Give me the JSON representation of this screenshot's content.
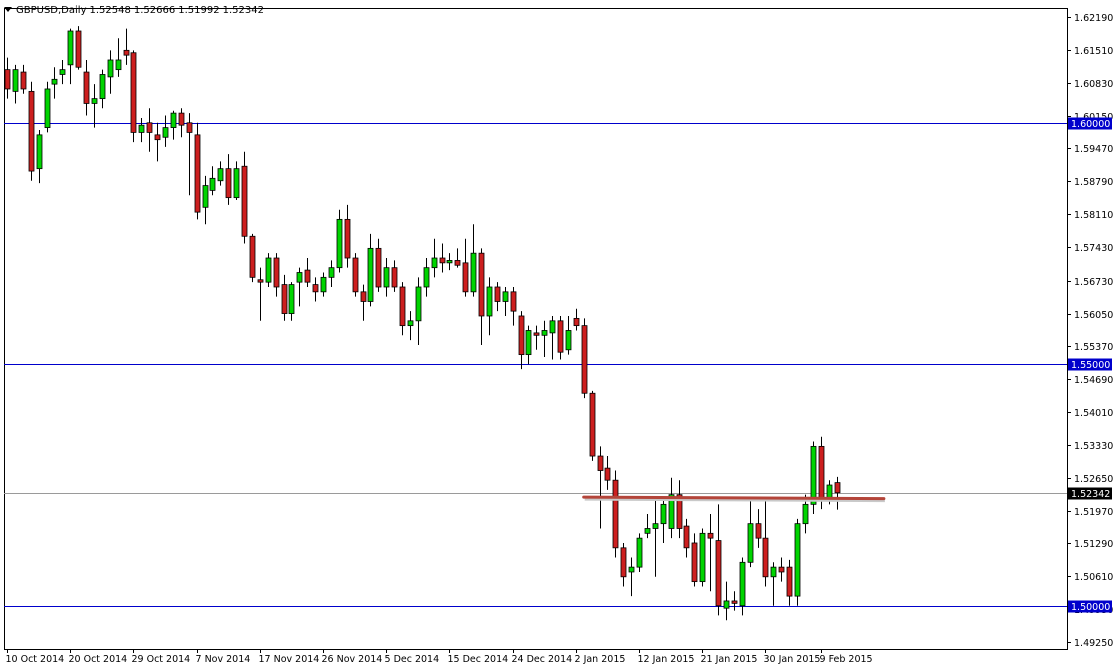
{
  "header": {
    "symbol": "GBPUSD,Daily",
    "open": "1.52548",
    "high": "1.52666",
    "low": "1.51992",
    "close": "1.52342"
  },
  "colors": {
    "bull": "#00d400",
    "bear": "#cc1f1f",
    "wick": "#000000",
    "hline": "#0000cc",
    "resistance": "#b4453a",
    "bidline": "#9a9a9a",
    "axis": "#000000"
  },
  "chart_data": {
    "type": "candlestick",
    "symbol": "GBPUSD",
    "timeframe": "Daily",
    "ylim": [
      1.4925,
      1.6219
    ],
    "y_ticks": [
      "1.62190",
      "1.61510",
      "1.60830",
      "1.60150",
      "1.59470",
      "1.58790",
      "1.58110",
      "1.57430",
      "1.56730",
      "1.56050",
      "1.55370",
      "1.54690",
      "1.54010",
      "1.53330",
      "1.52650",
      "1.51970",
      "1.51290",
      "1.50610",
      "1.49930",
      "1.49250"
    ],
    "x_labels": [
      "10 Oct 2014",
      "20 Oct 2014",
      "29 Oct 2014",
      "7 Nov 2014",
      "17 Nov 2014",
      "26 Nov 2014",
      "5 Dec 2014",
      "15 Dec 2014",
      "24 Dec 2014",
      "2 Jan 2015",
      "12 Jan 2015",
      "21 Jan 2015",
      "30 Jan 2015",
      "9 Feb 2015"
    ],
    "x_label_index": [
      0,
      8,
      16,
      24,
      32,
      40,
      48,
      56,
      64,
      72,
      80,
      88,
      96,
      103
    ],
    "horizontal_lines": [
      {
        "label": "1.60000",
        "price": 1.6
      },
      {
        "label": "1.55000",
        "price": 1.55
      },
      {
        "label": "1.50000",
        "price": 1.5
      }
    ],
    "current_price": {
      "label": "1.52342",
      "price": 1.52342
    },
    "resistance_line": {
      "start_index": 73,
      "end_index": 111,
      "price": 1.5225
    },
    "candles": [
      {
        "o": 1.611,
        "h": 1.6135,
        "l": 1.605,
        "c": 1.607
      },
      {
        "o": 1.6065,
        "h": 1.612,
        "l": 1.604,
        "c": 1.611
      },
      {
        "o": 1.6105,
        "h": 1.612,
        "l": 1.606,
        "c": 1.607
      },
      {
        "o": 1.6065,
        "h": 1.6085,
        "l": 1.588,
        "c": 1.59
      },
      {
        "o": 1.5905,
        "h": 1.5985,
        "l": 1.5875,
        "c": 1.5975
      },
      {
        "o": 1.599,
        "h": 1.6085,
        "l": 1.598,
        "c": 1.607
      },
      {
        "o": 1.608,
        "h": 1.6115,
        "l": 1.605,
        "c": 1.609
      },
      {
        "o": 1.61,
        "h": 1.613,
        "l": 1.608,
        "c": 1.611
      },
      {
        "o": 1.612,
        "h": 1.6195,
        "l": 1.608,
        "c": 1.619
      },
      {
        "o": 1.619,
        "h": 1.62,
        "l": 1.611,
        "c": 1.6115
      },
      {
        "o": 1.6105,
        "h": 1.613,
        "l": 1.6015,
        "c": 1.604
      },
      {
        "o": 1.604,
        "h": 1.608,
        "l": 1.599,
        "c": 1.605
      },
      {
        "o": 1.605,
        "h": 1.611,
        "l": 1.603,
        "c": 1.61
      },
      {
        "o": 1.6095,
        "h": 1.615,
        "l": 1.606,
        "c": 1.613
      },
      {
        "o": 1.611,
        "h": 1.6175,
        "l": 1.6095,
        "c": 1.613
      },
      {
        "o": 1.615,
        "h": 1.6195,
        "l": 1.612,
        "c": 1.614
      },
      {
        "o": 1.6145,
        "h": 1.615,
        "l": 1.596,
        "c": 1.598
      },
      {
        "o": 1.598,
        "h": 1.601,
        "l": 1.596,
        "c": 1.5995
      },
      {
        "o": 1.6,
        "h": 1.603,
        "l": 1.594,
        "c": 1.598
      },
      {
        "o": 1.5975,
        "h": 1.6,
        "l": 1.592,
        "c": 1.5965
      },
      {
        "o": 1.597,
        "h": 1.6015,
        "l": 1.595,
        "c": 1.599
      },
      {
        "o": 1.599,
        "h": 1.6025,
        "l": 1.5965,
        "c": 1.602
      },
      {
        "o": 1.602,
        "h": 1.603,
        "l": 1.597,
        "c": 1.5995
      },
      {
        "o": 1.6,
        "h": 1.602,
        "l": 1.585,
        "c": 1.598
      },
      {
        "o": 1.5975,
        "h": 1.6,
        "l": 1.58,
        "c": 1.5815
      },
      {
        "o": 1.5825,
        "h": 1.589,
        "l": 1.579,
        "c": 1.587
      },
      {
        "o": 1.586,
        "h": 1.591,
        "l": 1.585,
        "c": 1.5885
      },
      {
        "o": 1.588,
        "h": 1.592,
        "l": 1.587,
        "c": 1.5905
      },
      {
        "o": 1.5905,
        "h": 1.5935,
        "l": 1.583,
        "c": 1.5845
      },
      {
        "o": 1.5845,
        "h": 1.592,
        "l": 1.584,
        "c": 1.5905
      },
      {
        "o": 1.591,
        "h": 1.594,
        "l": 1.575,
        "c": 1.5765
      },
      {
        "o": 1.5765,
        "h": 1.577,
        "l": 1.567,
        "c": 1.568
      },
      {
        "o": 1.5675,
        "h": 1.57,
        "l": 1.559,
        "c": 1.567
      },
      {
        "o": 1.567,
        "h": 1.573,
        "l": 1.566,
        "c": 1.572
      },
      {
        "o": 1.572,
        "h": 1.573,
        "l": 1.564,
        "c": 1.566
      },
      {
        "o": 1.5665,
        "h": 1.5685,
        "l": 1.559,
        "c": 1.5605
      },
      {
        "o": 1.5605,
        "h": 1.567,
        "l": 1.559,
        "c": 1.5665
      },
      {
        "o": 1.567,
        "h": 1.57,
        "l": 1.562,
        "c": 1.569
      },
      {
        "o": 1.5695,
        "h": 1.572,
        "l": 1.566,
        "c": 1.567
      },
      {
        "o": 1.5665,
        "h": 1.568,
        "l": 1.563,
        "c": 1.565
      },
      {
        "o": 1.565,
        "h": 1.569,
        "l": 1.564,
        "c": 1.568
      },
      {
        "o": 1.568,
        "h": 1.5715,
        "l": 1.566,
        "c": 1.57
      },
      {
        "o": 1.57,
        "h": 1.582,
        "l": 1.569,
        "c": 1.58
      },
      {
        "o": 1.58,
        "h": 1.583,
        "l": 1.57,
        "c": 1.572
      },
      {
        "o": 1.572,
        "h": 1.573,
        "l": 1.564,
        "c": 1.565
      },
      {
        "o": 1.565,
        "h": 1.5665,
        "l": 1.559,
        "c": 1.563
      },
      {
        "o": 1.563,
        "h": 1.577,
        "l": 1.562,
        "c": 1.574
      },
      {
        "o": 1.574,
        "h": 1.576,
        "l": 1.565,
        "c": 1.566
      },
      {
        "o": 1.566,
        "h": 1.572,
        "l": 1.564,
        "c": 1.57
      },
      {
        "o": 1.57,
        "h": 1.5715,
        "l": 1.565,
        "c": 1.566
      },
      {
        "o": 1.566,
        "h": 1.567,
        "l": 1.556,
        "c": 1.558
      },
      {
        "o": 1.558,
        "h": 1.561,
        "l": 1.555,
        "c": 1.559
      },
      {
        "o": 1.559,
        "h": 1.568,
        "l": 1.554,
        "c": 1.566
      },
      {
        "o": 1.566,
        "h": 1.572,
        "l": 1.564,
        "c": 1.57
      },
      {
        "o": 1.57,
        "h": 1.576,
        "l": 1.568,
        "c": 1.572
      },
      {
        "o": 1.572,
        "h": 1.575,
        "l": 1.569,
        "c": 1.571
      },
      {
        "o": 1.571,
        "h": 1.573,
        "l": 1.5695,
        "c": 1.5715
      },
      {
        "o": 1.5715,
        "h": 1.574,
        "l": 1.57,
        "c": 1.5705
      },
      {
        "o": 1.571,
        "h": 1.576,
        "l": 1.564,
        "c": 1.565
      },
      {
        "o": 1.565,
        "h": 1.579,
        "l": 1.564,
        "c": 1.573
      },
      {
        "o": 1.573,
        "h": 1.574,
        "l": 1.554,
        "c": 1.56
      },
      {
        "o": 1.56,
        "h": 1.568,
        "l": 1.556,
        "c": 1.566
      },
      {
        "o": 1.566,
        "h": 1.567,
        "l": 1.561,
        "c": 1.563
      },
      {
        "o": 1.563,
        "h": 1.566,
        "l": 1.56,
        "c": 1.565
      },
      {
        "o": 1.565,
        "h": 1.566,
        "l": 1.558,
        "c": 1.561
      },
      {
        "o": 1.56,
        "h": 1.561,
        "l": 1.549,
        "c": 1.552
      },
      {
        "o": 1.552,
        "h": 1.558,
        "l": 1.55,
        "c": 1.557
      },
      {
        "o": 1.5565,
        "h": 1.558,
        "l": 1.553,
        "c": 1.556
      },
      {
        "o": 1.556,
        "h": 1.559,
        "l": 1.5515,
        "c": 1.557
      },
      {
        "o": 1.5565,
        "h": 1.56,
        "l": 1.551,
        "c": 1.559
      },
      {
        "o": 1.559,
        "h": 1.56,
        "l": 1.551,
        "c": 1.5525
      },
      {
        "o": 1.553,
        "h": 1.56,
        "l": 1.552,
        "c": 1.557
      },
      {
        "o": 1.5595,
        "h": 1.5615,
        "l": 1.557,
        "c": 1.558
      },
      {
        "o": 1.558,
        "h": 1.5595,
        "l": 1.543,
        "c": 1.544
      },
      {
        "o": 1.544,
        "h": 1.5445,
        "l": 1.53,
        "c": 1.531
      },
      {
        "o": 1.531,
        "h": 1.533,
        "l": 1.516,
        "c": 1.528
      },
      {
        "o": 1.5285,
        "h": 1.531,
        "l": 1.524,
        "c": 1.526
      },
      {
        "o": 1.526,
        "h": 1.528,
        "l": 1.51,
        "c": 1.512
      },
      {
        "o": 1.512,
        "h": 1.513,
        "l": 1.504,
        "c": 1.506
      },
      {
        "o": 1.507,
        "h": 1.51,
        "l": 1.502,
        "c": 1.508
      },
      {
        "o": 1.508,
        "h": 1.515,
        "l": 1.507,
        "c": 1.514
      },
      {
        "o": 1.515,
        "h": 1.519,
        "l": 1.514,
        "c": 1.516
      },
      {
        "o": 1.516,
        "h": 1.522,
        "l": 1.506,
        "c": 1.517
      },
      {
        "o": 1.517,
        "h": 1.5225,
        "l": 1.513,
        "c": 1.521
      },
      {
        "o": 1.516,
        "h": 1.5265,
        "l": 1.514,
        "c": 1.523
      },
      {
        "o": 1.523,
        "h": 1.526,
        "l": 1.514,
        "c": 1.516
      },
      {
        "o": 1.5165,
        "h": 1.518,
        "l": 1.51,
        "c": 1.512
      },
      {
        "o": 1.513,
        "h": 1.515,
        "l": 1.504,
        "c": 1.505
      },
      {
        "o": 1.505,
        "h": 1.516,
        "l": 1.504,
        "c": 1.515
      },
      {
        "o": 1.515,
        "h": 1.519,
        "l": 1.503,
        "c": 1.514
      },
      {
        "o": 1.5135,
        "h": 1.521,
        "l": 1.498,
        "c": 1.5
      },
      {
        "o": 1.4995,
        "h": 1.505,
        "l": 1.497,
        "c": 1.501
      },
      {
        "o": 1.501,
        "h": 1.503,
        "l": 1.499,
        "c": 1.5005
      },
      {
        "o": 1.5,
        "h": 1.51,
        "l": 1.498,
        "c": 1.509
      },
      {
        "o": 1.509,
        "h": 1.522,
        "l": 1.508,
        "c": 1.517
      },
      {
        "o": 1.517,
        "h": 1.52,
        "l": 1.512,
        "c": 1.514
      },
      {
        "o": 1.514,
        "h": 1.522,
        "l": 1.504,
        "c": 1.506
      },
      {
        "o": 1.506,
        "h": 1.509,
        "l": 1.5,
        "c": 1.508
      },
      {
        "o": 1.508,
        "h": 1.51,
        "l": 1.505,
        "c": 1.507
      },
      {
        "o": 1.508,
        "h": 1.5095,
        "l": 1.5,
        "c": 1.502
      },
      {
        "o": 1.502,
        "h": 1.518,
        "l": 1.5,
        "c": 1.517
      },
      {
        "o": 1.517,
        "h": 1.523,
        "l": 1.515,
        "c": 1.521
      },
      {
        "o": 1.521,
        "h": 1.534,
        "l": 1.519,
        "c": 1.533
      },
      {
        "o": 1.533,
        "h": 1.535,
        "l": 1.52,
        "c": 1.522
      },
      {
        "o": 1.522,
        "h": 1.526,
        "l": 1.521,
        "c": 1.525
      },
      {
        "o": 1.5255,
        "h": 1.5267,
        "l": 1.5199,
        "c": 1.5234
      }
    ]
  }
}
